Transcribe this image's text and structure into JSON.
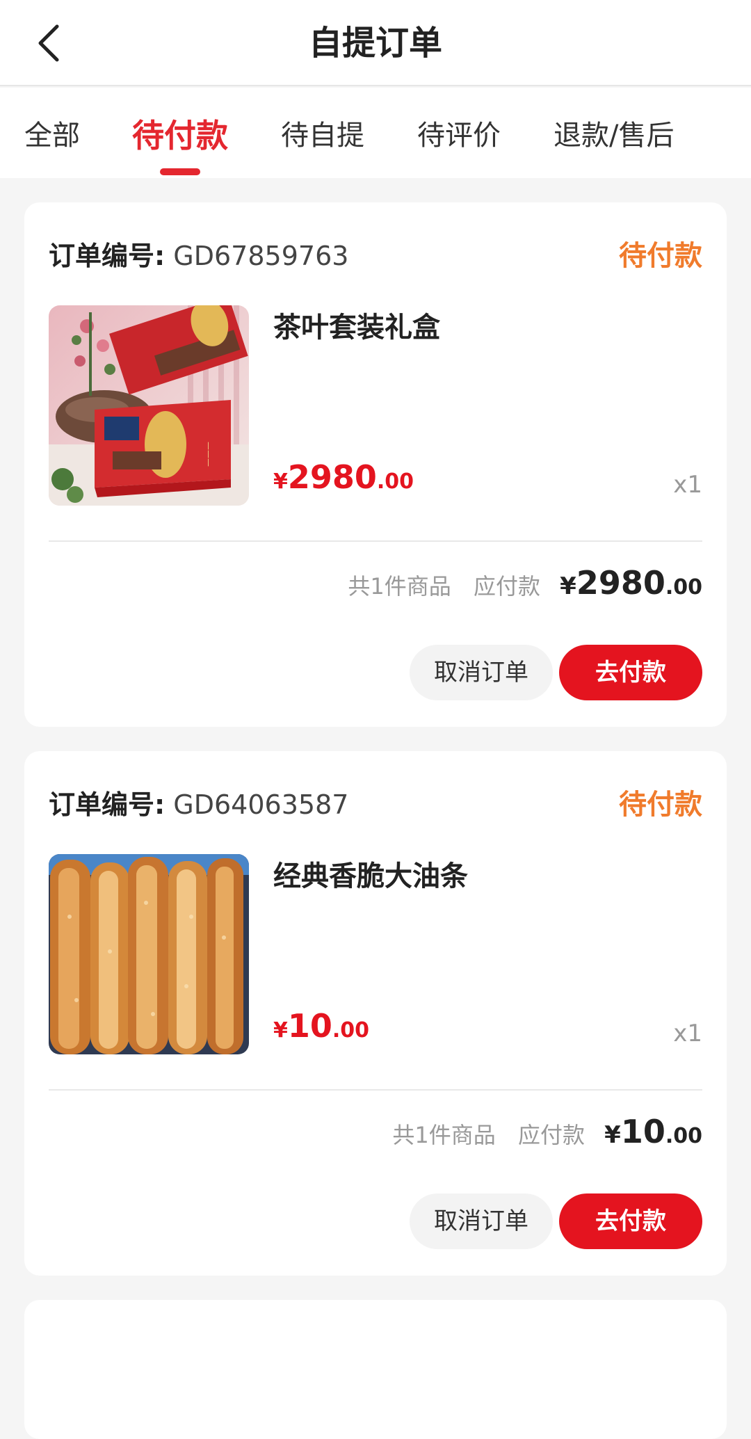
{
  "header": {
    "title": "自提订单"
  },
  "tabs": [
    {
      "label": "全部"
    },
    {
      "label": "待付款"
    },
    {
      "label": "待自提"
    },
    {
      "label": "待评价"
    },
    {
      "label": "退款/售后"
    }
  ],
  "active_tab": "待付款",
  "colors": {
    "accent": "#e4141f",
    "status": "#f07b2c"
  },
  "orders": [
    {
      "order_no_label": "订单编号:",
      "order_no": "GD67859763",
      "status": "待付款",
      "product_name": "茶叶套装礼盒",
      "price_currency": "¥",
      "price_int": "2980",
      "price_dec": ".00",
      "qty": "x1",
      "count_text": "共1件商品",
      "due_label": "应付款",
      "total_currency": "¥",
      "total_int": "2980",
      "total_dec": ".00",
      "cancel_label": "取消订单",
      "pay_label": "去付款",
      "image_icon": "tea-gift-box-image"
    },
    {
      "order_no_label": "订单编号:",
      "order_no": "GD64063587",
      "status": "待付款",
      "product_name": "经典香脆大油条",
      "price_currency": "¥",
      "price_int": "10",
      "price_dec": ".00",
      "qty": "x1",
      "count_text": "共1件商品",
      "due_label": "应付款",
      "total_currency": "¥",
      "total_int": "10",
      "total_dec": ".00",
      "cancel_label": "取消订单",
      "pay_label": "去付款",
      "image_icon": "fried-dough-sticks-image"
    }
  ]
}
